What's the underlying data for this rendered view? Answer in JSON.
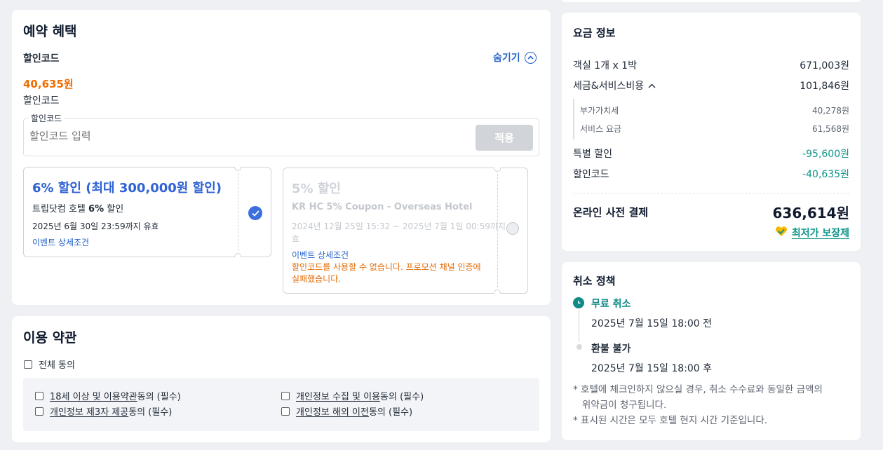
{
  "benefits": {
    "title": "예약 혜택",
    "code_label": "할인코드",
    "hide_label": "숨기기",
    "applied_amount": "40,635원",
    "applied_label": "할인코드",
    "input_legend": "할인코드",
    "input_placeholder": "할인코드 입력",
    "apply_label": "적용",
    "coupon1": {
      "title": "6% 할인 (최대 300,000원 할인)",
      "subtitle_prefix": "트립닷컴 호텔 ",
      "subtitle_bold": "6%",
      "subtitle_suffix": " 할인",
      "validity": "2025년 6월 30일 23:59까지 유효",
      "link": "이벤트 상세조건",
      "selected": true
    },
    "coupon2": {
      "title": "5% 할인",
      "subtitle": "KR HC 5% Coupon - Overseas Hotel",
      "validity_line1": "2024년 12월 25일 15:32 ~ 2025년 7월 1일 00:59까지 유",
      "validity_line2": "효",
      "link": "이벤트 상세조건",
      "error_line1": "할인코드를 사용할 수 없습니다. 프로모션 채널 인증에",
      "error_line2": "실패했습니다.",
      "selected": false
    }
  },
  "terms": {
    "title": "이용 약관",
    "all_agree": "전체 동의",
    "items": [
      {
        "link": "18세 이상 및 이용약관",
        "suffix": "동의 (필수)"
      },
      {
        "link": "개인정보 수집 및 이용",
        "suffix": "동의 (필수)"
      },
      {
        "link": "개인정보 제3자 제공",
        "suffix": "동의 (필수)"
      },
      {
        "link": "개인정보 해외 이전",
        "suffix": "동의 (필수)"
      }
    ]
  },
  "price": {
    "title": "요금 정보",
    "room_label": "객실 1개 x 1박",
    "room_value": "671,003원",
    "tax_label": "세금&서비스비용",
    "tax_value": "101,846원",
    "vat_label": "부가가치세",
    "vat_value": "40,278원",
    "service_label": "서비스 요금",
    "service_value": "61,568원",
    "special_label": "특별 할인",
    "special_value": "-95,600원",
    "code_label": "할인코드",
    "code_value": "-40,635원",
    "total_label": "온라인 사전 결제",
    "total_value": "636,614원",
    "best_price": "최저가 보장제"
  },
  "cancel": {
    "title": "취소 정책",
    "free_label": "무료 취소",
    "free_date": "2025년 7월 15일 18:00 전",
    "nonref_label": "환불 불가",
    "nonref_date": "2025년 7월 15일 18:00 후",
    "note1_line1": "* 호텔에 체크인하지 않으실 경우, 취소 수수료와 동일한 금액의",
    "note1_line2": "   위약금이 청구됩니다.",
    "note2": "* 표시된 시간은 모두 호텔 현지 시간 기준입니다."
  },
  "colors": {
    "accent_blue": "#2563c9",
    "discount_orange": "#ef6c00",
    "teal": "#0f9488",
    "error_orange": "#e36a00"
  }
}
